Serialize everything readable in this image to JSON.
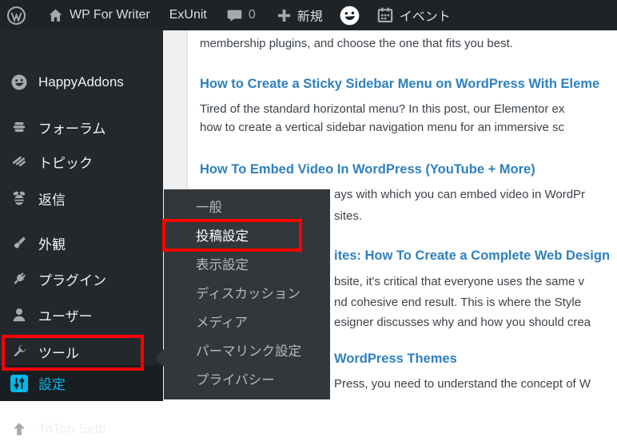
{
  "admin_bar": {
    "site_name": "WP For Writer",
    "exunit_label": "ExUnit",
    "comment_count": "0",
    "new_label": "新規",
    "events_label": "イベント"
  },
  "sidebar": {
    "items": [
      {
        "label": "HappyAddons"
      },
      {
        "label": "フォーラム"
      },
      {
        "label": "トピック"
      },
      {
        "label": "返信"
      },
      {
        "label": "外観"
      },
      {
        "label": "プラグイン"
      },
      {
        "label": "ユーザー"
      },
      {
        "label": "ツール"
      },
      {
        "label": "設定"
      },
      {
        "label": "ToTop Setti"
      }
    ]
  },
  "settings_submenu": {
    "items": [
      "一般",
      "投稿設定",
      "表示設定",
      "ディスカッション",
      "メディア",
      "パーマリンク設定",
      "プライバシー"
    ],
    "highlighted": "投稿設定"
  },
  "content": {
    "lines": [
      {
        "text": "membership plugins, and choose the one that fits you best."
      },
      {
        "text": "How to Create a Sticky Sidebar Menu on WordPress With Eleme"
      },
      {
        "text": "Tired of the standard horizontal menu? In this post, our Elementor ex"
      },
      {
        "text": "how to create a vertical sidebar navigation menu for an immersive sc"
      },
      {
        "text": "How To Embed Video In WordPress (YouTube + More)"
      },
      {
        "text": "ays with which you can embed video in WordPr"
      },
      {
        "text": "sites."
      },
      {
        "text": "ites: How To Create a Complete Web Design"
      },
      {
        "text": "bsite, it's critical that everyone uses the same v"
      },
      {
        "text": "nd cohesive end result. This is where the Style"
      },
      {
        "text": "esigner discusses why and how you should crea"
      },
      {
        "text": "WordPress Themes"
      },
      {
        "text": "Press, you need to understand the concept of W"
      }
    ]
  },
  "colors": {
    "accent_cyan": "#00b9eb",
    "link_blue": "#2e80be",
    "highlight_red": "#ff0000",
    "admin_bar_bg": "#1d2327",
    "sidebar_bg": "#23282d",
    "flyout_bg": "#32373c"
  }
}
